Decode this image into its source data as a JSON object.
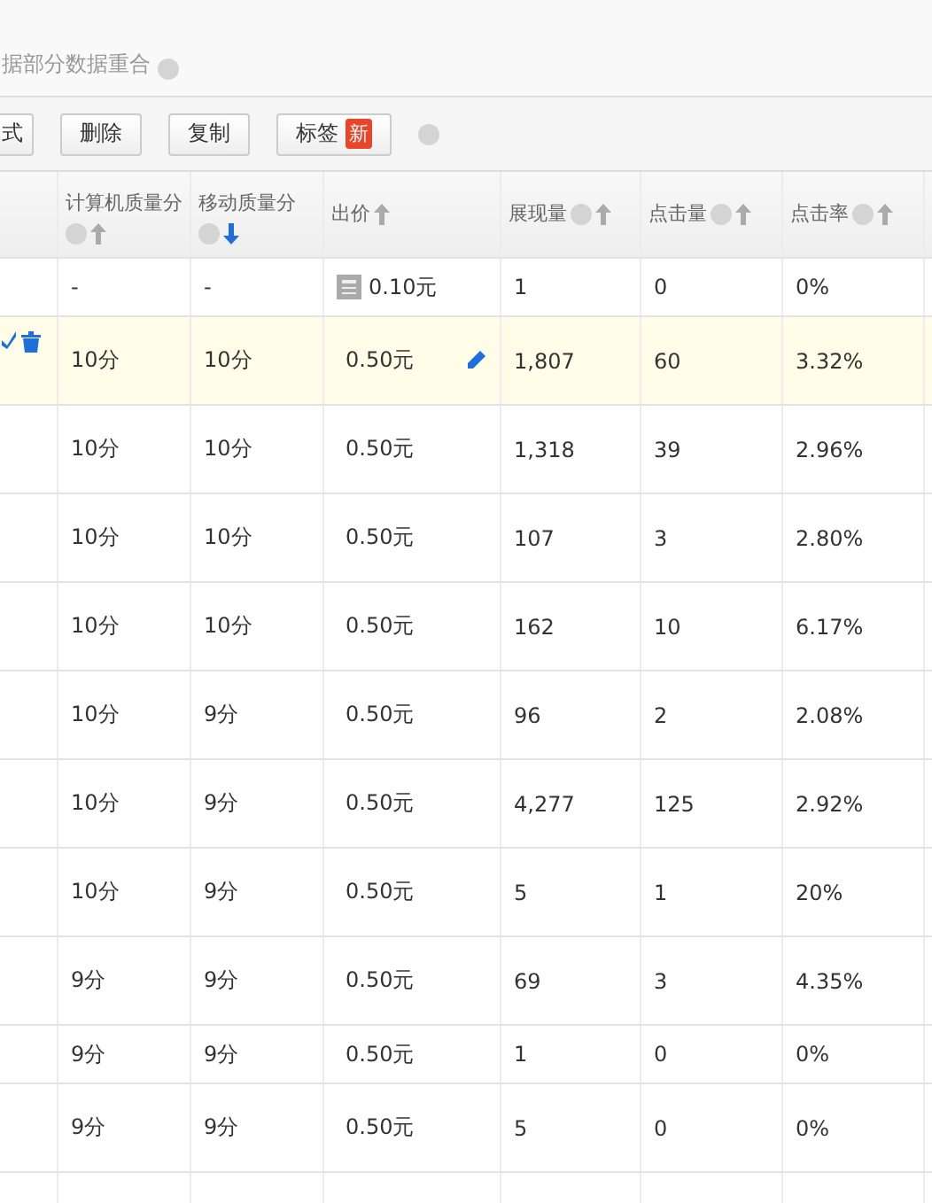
{
  "notice": {
    "text": "据部分数据重合"
  },
  "toolbar": {
    "buttons": [
      {
        "label": "式"
      },
      {
        "label": "删除"
      },
      {
        "label": "复制"
      },
      {
        "label": "标签",
        "badge": "新"
      }
    ]
  },
  "table": {
    "columns": [
      {
        "label": "计算机质量分",
        "help": true,
        "sorted": false
      },
      {
        "label": "移动质量分",
        "help": true,
        "sorted": true
      },
      {
        "label": "出价",
        "help": false,
        "sorted": false
      },
      {
        "label": "展现量",
        "help": true,
        "sorted": false
      },
      {
        "label": "点击量",
        "help": true,
        "sorted": false
      },
      {
        "label": "点击率",
        "help": true,
        "sorted": false
      }
    ],
    "rows": [
      {
        "compact": true,
        "highlighted": false,
        "default_bid": true,
        "cells": [
          "-",
          "-",
          "0.10元",
          "1",
          "0",
          "0%"
        ]
      },
      {
        "compact": false,
        "highlighted": true,
        "default_bid": false,
        "cells": [
          "10分",
          "10分",
          "0.50元",
          "1,807",
          "60",
          "3.32%"
        ]
      },
      {
        "compact": false,
        "highlighted": false,
        "default_bid": false,
        "cells": [
          "10分",
          "10分",
          "0.50元",
          "1,318",
          "39",
          "2.96%"
        ]
      },
      {
        "compact": false,
        "highlighted": false,
        "default_bid": false,
        "cells": [
          "10分",
          "10分",
          "0.50元",
          "107",
          "3",
          "2.80%"
        ]
      },
      {
        "compact": false,
        "highlighted": false,
        "default_bid": false,
        "cells": [
          "10分",
          "10分",
          "0.50元",
          "162",
          "10",
          "6.17%"
        ]
      },
      {
        "compact": false,
        "highlighted": false,
        "default_bid": false,
        "cells": [
          "10分",
          "9分",
          "0.50元",
          "96",
          "2",
          "2.08%"
        ]
      },
      {
        "compact": false,
        "highlighted": false,
        "default_bid": false,
        "cells": [
          "10分",
          "9分",
          "0.50元",
          "4,277",
          "125",
          "2.92%"
        ]
      },
      {
        "compact": false,
        "highlighted": false,
        "default_bid": false,
        "cells": [
          "10分",
          "9分",
          "0.50元",
          "5",
          "1",
          "20%"
        ]
      },
      {
        "compact": false,
        "highlighted": false,
        "default_bid": false,
        "cells": [
          "9分",
          "9分",
          "0.50元",
          "69",
          "3",
          "4.35%"
        ]
      },
      {
        "compact": true,
        "highlighted": false,
        "default_bid": false,
        "cells": [
          "9分",
          "9分",
          "0.50元",
          "1",
          "0",
          "0%"
        ]
      },
      {
        "compact": false,
        "highlighted": false,
        "default_bid": false,
        "cells": [
          "9分",
          "9分",
          "0.50元",
          "5",
          "0",
          "0%"
        ]
      }
    ]
  }
}
